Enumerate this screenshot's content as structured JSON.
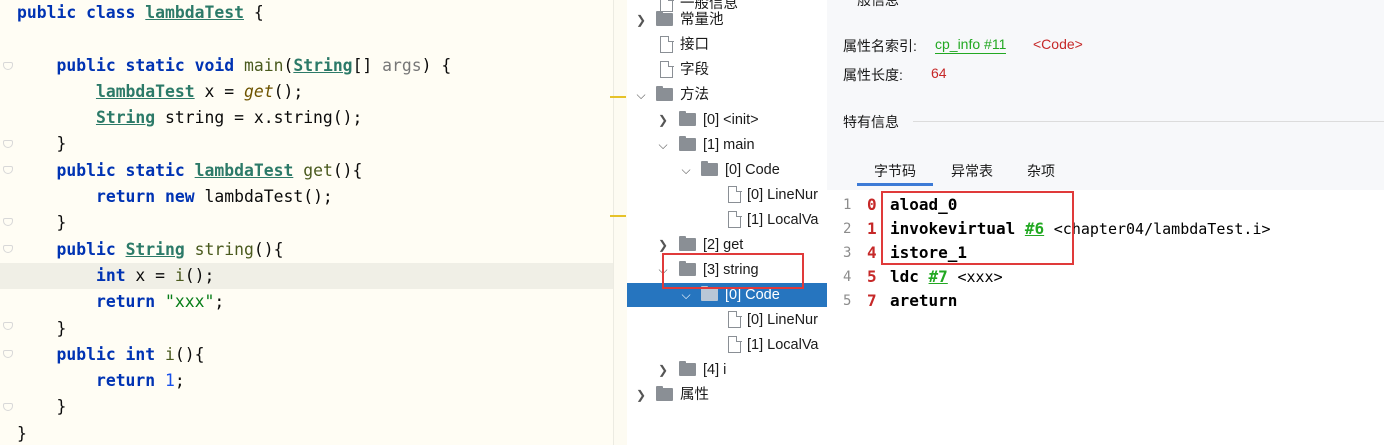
{
  "editor": {
    "lines": [
      [
        [
          "kw",
          "public class "
        ],
        [
          "cls",
          "lambdaTest"
        ],
        [
          "plain",
          " {"
        ]
      ],
      [],
      [
        [
          "plain",
          "    "
        ],
        [
          "kw",
          "public static void "
        ],
        [
          "mdef",
          "main"
        ],
        [
          "plain",
          "("
        ],
        [
          "cls",
          "String"
        ],
        [
          "plain",
          "[] "
        ],
        [
          "param",
          "args"
        ],
        [
          "plain",
          ") {"
        ]
      ],
      [
        [
          "plain",
          "        "
        ],
        [
          "cls",
          "lambdaTest"
        ],
        [
          "plain",
          " x = "
        ],
        [
          "mcall",
          "get"
        ],
        [
          "plain",
          "();"
        ]
      ],
      [
        [
          "plain",
          "        "
        ],
        [
          "cls",
          "String"
        ],
        [
          "plain",
          " string = x.string();"
        ]
      ],
      [
        [
          "plain",
          "    }"
        ]
      ],
      [
        [
          "plain",
          "    "
        ],
        [
          "kw",
          "public static "
        ],
        [
          "cls",
          "lambdaTest"
        ],
        [
          "plain",
          " "
        ],
        [
          "mdef",
          "get"
        ],
        [
          "plain",
          "(){"
        ]
      ],
      [
        [
          "plain",
          "        "
        ],
        [
          "kw",
          "return new "
        ],
        [
          "plain",
          "lambdaTest();"
        ]
      ],
      [
        [
          "plain",
          "    }"
        ]
      ],
      [
        [
          "plain",
          "    "
        ],
        [
          "kw",
          "public "
        ],
        [
          "cls",
          "String"
        ],
        [
          "plain",
          " "
        ],
        [
          "mdef",
          "string"
        ],
        [
          "plain",
          "(){"
        ]
      ],
      [
        [
          "plain",
          "        "
        ],
        [
          "kw",
          "int"
        ],
        [
          "plain",
          " x = "
        ],
        [
          "mdef",
          "i"
        ],
        [
          "plain",
          "();"
        ]
      ],
      [
        [
          "plain",
          "        "
        ],
        [
          "kw",
          "return "
        ],
        [
          "str",
          "\"xxx\""
        ],
        [
          "plain",
          ";"
        ]
      ],
      [
        [
          "plain",
          "    }"
        ]
      ],
      [
        [
          "plain",
          "    "
        ],
        [
          "kw",
          "public int "
        ],
        [
          "mdef",
          "i"
        ],
        [
          "plain",
          "(){"
        ]
      ],
      [
        [
          "plain",
          "        "
        ],
        [
          "kw",
          "return "
        ],
        [
          "num",
          "1"
        ],
        [
          "plain",
          ";"
        ]
      ],
      [
        [
          "plain",
          "    }"
        ]
      ],
      [
        [
          "plain",
          "}"
        ]
      ]
    ]
  },
  "tree": {
    "items": [
      {
        "label": "一般信息"
      },
      {
        "label": "常量池"
      },
      {
        "label": "接口"
      },
      {
        "label": "字段"
      },
      {
        "label": "方法"
      },
      {
        "label": "[0] <init>"
      },
      {
        "label": "[1] main"
      },
      {
        "label": "[0] Code"
      },
      {
        "label": "[0] LineNur"
      },
      {
        "label": "[1] LocalVa"
      },
      {
        "label": "[2] get"
      },
      {
        "label": "[3] string"
      },
      {
        "label": "[0] Code"
      },
      {
        "label": "[0] LineNur"
      },
      {
        "label": "[1] LocalVa"
      },
      {
        "label": "[4] i"
      },
      {
        "label": "属性"
      }
    ]
  },
  "detail": {
    "general_header": "一般信息",
    "name_index_label": "属性名索引:",
    "name_index_link": "cp_info #11",
    "name_index_value": "<Code>",
    "length_label": "属性长度:",
    "length_value": "64",
    "specific_header": "特有信息",
    "tabs": [
      "字节码",
      "异常表",
      "杂项"
    ]
  },
  "bytecode": [
    {
      "line": "1",
      "offset": "0",
      "op": "aload_0",
      "ref": "",
      "comment": ""
    },
    {
      "line": "2",
      "offset": "1",
      "op": "invokevirtual",
      "ref": "#6",
      "comment": "<chapter04/lambdaTest.i>"
    },
    {
      "line": "3",
      "offset": "4",
      "op": "istore_1",
      "ref": "",
      "comment": ""
    },
    {
      "line": "4",
      "offset": "5",
      "op": "ldc",
      "ref": "#7",
      "comment": "<xxx>"
    },
    {
      "line": "5",
      "offset": "7",
      "op": "areturn",
      "ref": "",
      "comment": ""
    }
  ],
  "colors": {
    "selection": "#2675bf",
    "highlight_box": "#e03a3a",
    "link": "#22a822",
    "offset": "#c62828"
  }
}
